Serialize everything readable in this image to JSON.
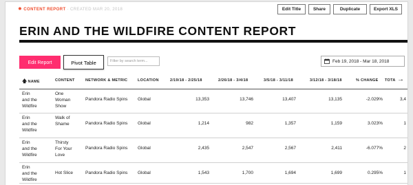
{
  "header": {
    "breadcrumb_label": "CONTENT REPORT",
    "breadcrumb_sep": "·",
    "created": "CREATED MAR 20, 2018",
    "icon": "gear-icon",
    "actions": {
      "edit_title": "Edit Title",
      "share": "Share",
      "duplicate": "Duplicate",
      "export": "Export XLS"
    }
  },
  "page_title": "ERIN AND THE WILDFIRE CONTENT REPORT",
  "toolbar": {
    "edit_report": "Edit Report",
    "pivot_table": "Pivot Table",
    "search_placeholder": "Filter by search term...",
    "date_range": "Feb 19, 2018 - Mar 18, 2018",
    "date_icon": "calendar-icon"
  },
  "table": {
    "columns": [
      "NAME",
      "CONTENT",
      "NETWORK & METRIC",
      "LOCATION",
      "2/19/18 - 2/25/18",
      "2/26/18 - 3/4/18",
      "3/5/18 - 3/11/18",
      "3/12/18 - 3/18/18",
      "% CHANGE",
      "TOTA"
    ],
    "sort_icon": "sort-up-arrow-icon",
    "next_icon": "arrow-right-icon",
    "rows": [
      {
        "name": [
          "Erin",
          "and the",
          "Wildfire"
        ],
        "content": [
          "One",
          "Woman",
          "Show"
        ],
        "network": "Pandora Radio Spins",
        "location": "Global",
        "w1": "13,353",
        "w2": "13,746",
        "w3": "13,407",
        "w4": "13,135",
        "change": "-2.029%",
        "total": "3,4"
      },
      {
        "name": [
          "Erin",
          "and the",
          "Wildfire"
        ],
        "content": [
          "Walk of",
          "Shame"
        ],
        "network": "Pandora Radio Spins",
        "location": "Global",
        "w1": "1,214",
        "w2": "982",
        "w3": "1,357",
        "w4": "1,159",
        "change": "3.023%",
        "total": "1"
      },
      {
        "name": [
          "Erin",
          "and the",
          "Wildfire"
        ],
        "content": [
          "Thirsty",
          "For Your",
          "Love"
        ],
        "network": "Pandora Radio Spins",
        "location": "Global",
        "w1": "2,435",
        "w2": "2,547",
        "w3": "2,567",
        "w4": "2,411",
        "change": "-6.077%",
        "total": "2"
      },
      {
        "name": [
          "Erin",
          "and the",
          "Wildfire"
        ],
        "content": [
          "Hot Slice"
        ],
        "network": "Pandora Radio Spins",
        "location": "Global",
        "w1": "1,543",
        "w2": "1,700",
        "w3": "1,694",
        "w4": "1,699",
        "change": "0.295%",
        "total": "1"
      }
    ]
  },
  "colors": {
    "accent": "#f04a2a",
    "edit_button": "#ff2d6f",
    "rule": "#111111"
  }
}
